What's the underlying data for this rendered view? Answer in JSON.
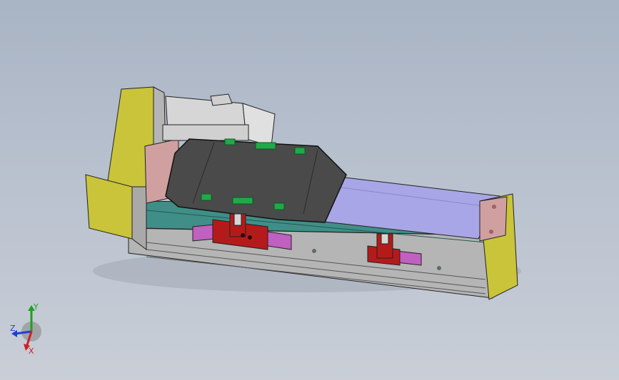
{
  "viewport": {
    "background_top": "#a9b4c4",
    "background_bottom": "#c9ced7"
  },
  "model": {
    "colors": {
      "motor_housing": "#c9c43a",
      "motor_body": "#d6d6d6",
      "carriage_cover": "#4a4a4a",
      "bellows": "#a8a6e6",
      "rail_base": "#b5b5b5",
      "rail_inner": "#3f8f88",
      "sensor_bracket": "#b51a1a",
      "sensor_block": "#c060c0",
      "end_plate": "#d0a0a0",
      "screw_marker": "#22a84a"
    }
  },
  "triad": {
    "x_label": "X",
    "y_label": "Y",
    "z_label": "Z",
    "x_color": "#d02020",
    "y_color": "#20a020",
    "z_color": "#2040d0"
  }
}
